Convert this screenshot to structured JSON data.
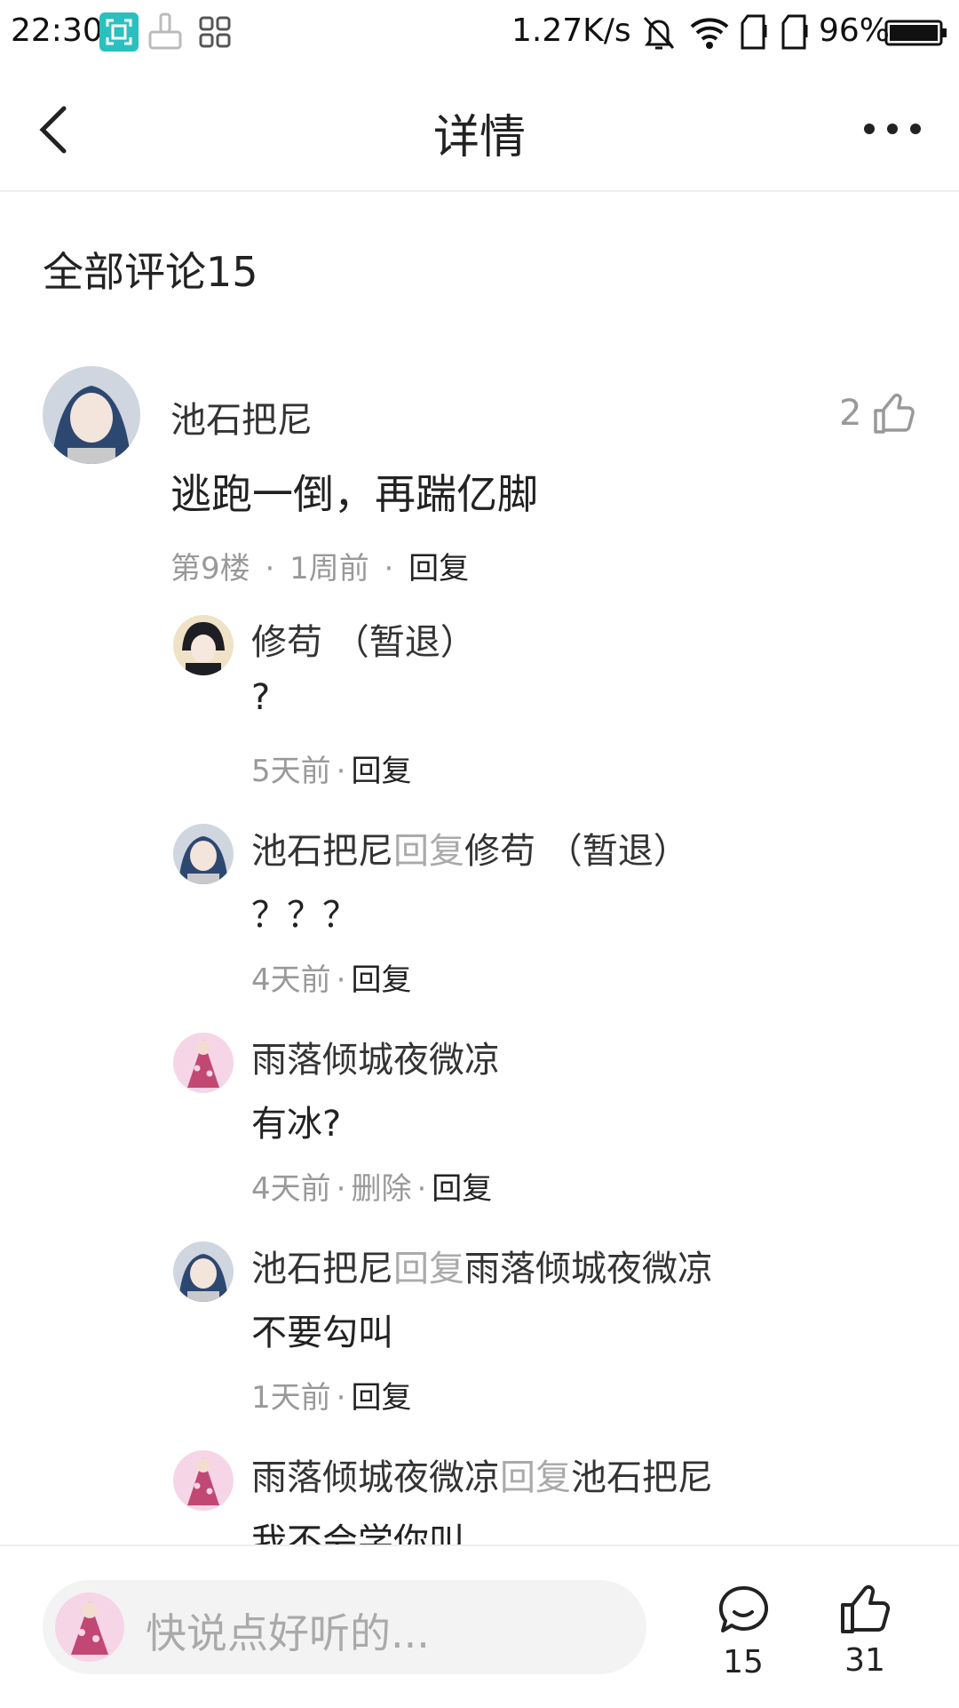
{
  "status_bar": {
    "time": "22:30",
    "speed": "1.27K/s",
    "battery": "96%",
    "icons": [
      "screen-scan-icon",
      "cleaner-icon",
      "apps-icon",
      "mute-bell-icon",
      "wifi-icon",
      "sim1-icon",
      "sim2-icon",
      "battery-icon"
    ]
  },
  "header": {
    "title": "详情",
    "back_icon": "back-chevron-icon",
    "more_icon": "more-dots-icon"
  },
  "section_title": "全部评论15",
  "main_comment": {
    "user": "池石把尼",
    "text": "逃跑一倒，再踹亿脚",
    "floor": "第9楼",
    "sep": "·",
    "time": "1周前",
    "reply": "回复",
    "likes": "2"
  },
  "replies": [
    {
      "user": "修苟 （暂退）",
      "reply_word": "",
      "target": "",
      "text": "?",
      "time": "5天前",
      "delete": "",
      "reply": "回复",
      "avatar": "dark"
    },
    {
      "user": "池石把尼",
      "reply_word": "回复",
      "target": "修苟 （暂退）",
      "text": "？？？",
      "time": "4天前",
      "delete": "",
      "reply": "回复",
      "avatar": "blue"
    },
    {
      "user": "雨落倾城夜微凉",
      "reply_word": "",
      "target": "",
      "text": "有冰?",
      "time": "4天前",
      "delete": "删除",
      "reply": "回复",
      "avatar": "pink"
    },
    {
      "user": "池石把尼",
      "reply_word": "回复",
      "target": "雨落倾城夜微凉",
      "text": "不要勾叫",
      "time": "1天前",
      "delete": "",
      "reply": "回复",
      "avatar": "blue"
    },
    {
      "user": "雨落倾城夜微凉",
      "reply_word": "回复",
      "target": "池石把尼",
      "text": "我不会学你叫",
      "time": "",
      "delete": "",
      "reply": "",
      "avatar": "pink"
    }
  ],
  "bottom_bar": {
    "placeholder": "快说点好听的...",
    "comment_count": "15",
    "like_count": "31"
  },
  "colors": {
    "accent_gray": "#aaaaaa",
    "text_dark": "#222222",
    "divider": "#eeeeee",
    "input_bg": "#f3f3f3",
    "scan_teal": "#2bbfbf"
  }
}
